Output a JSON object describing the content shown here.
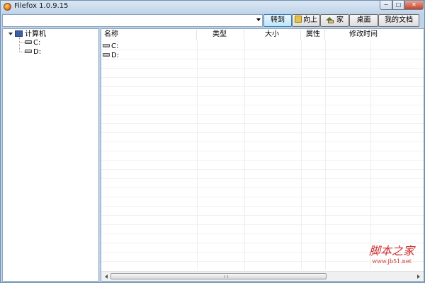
{
  "window": {
    "title": "Filefox 1.0.9.15",
    "controls": {
      "minimize": "−",
      "maximize": "□",
      "close": "✕"
    }
  },
  "toolbar": {
    "address_value": "",
    "go_label": "转到",
    "up_label": "向上",
    "home_label": "家",
    "desktop_label": "桌面",
    "documents_label": "我的文档"
  },
  "tree": {
    "root_label": "计算机",
    "items": [
      {
        "label": "C:",
        "icon": "drive-icon"
      },
      {
        "label": "D:",
        "icon": "drive-icon"
      }
    ]
  },
  "list": {
    "columns": [
      {
        "label": "名称"
      },
      {
        "label": "类型"
      },
      {
        "label": "大小"
      },
      {
        "label": "属性"
      },
      {
        "label": "修改时间"
      }
    ],
    "rows": [
      {
        "name": "C:",
        "icon": "drive-icon"
      },
      {
        "name": "D:",
        "icon": "drive-icon"
      }
    ]
  },
  "watermark": {
    "main": "脚本之家",
    "url": "www.jb51.net"
  },
  "colors": {
    "frame": "#bcd3ea",
    "watermark": "#cc2b2b"
  }
}
